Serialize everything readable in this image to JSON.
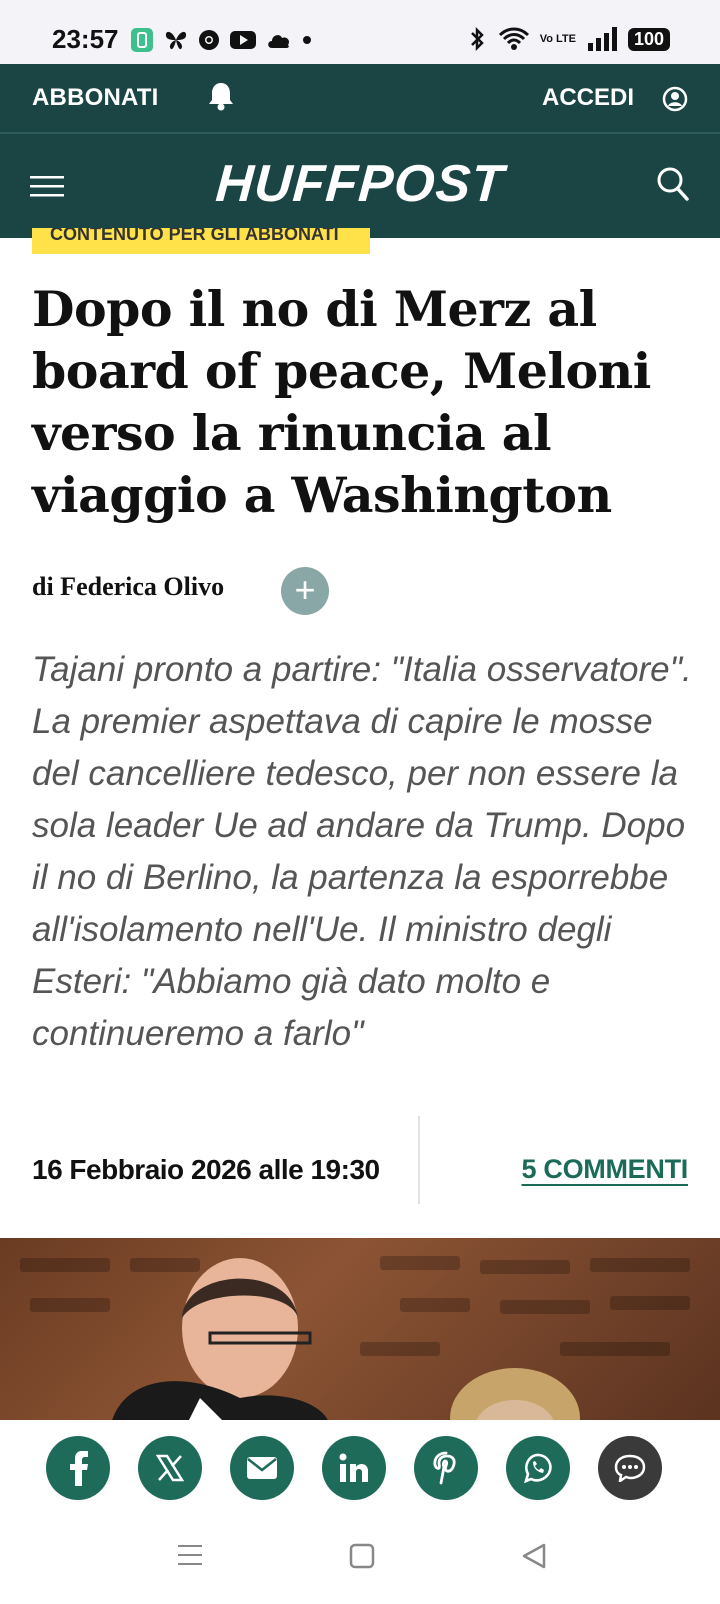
{
  "status_bar": {
    "time": "23:57",
    "battery": "100",
    "network": "Vo LTE",
    "app_icons": [
      "battery-saver-icon",
      "butterfly-icon",
      "chrome-icon",
      "youtube-icon",
      "cloud-icon",
      "dot-icon"
    ],
    "system_icons": [
      "bluetooth-icon",
      "wifi-icon",
      "signal-icon"
    ]
  },
  "top_bar": {
    "subscribe_label": "ABBONATI",
    "login_label": "ACCEDI"
  },
  "brand_bar": {
    "logo": "HUFFPOST"
  },
  "article": {
    "tag": "CONTENUTO PER GLI ABBONATI",
    "headline": "Dopo il no di Merz al board of peace, Meloni verso la rinuncia al viaggio a Washington",
    "byline": "di Federica Olivo",
    "follow_icon": "+",
    "summary": "Tajani pronto a partire: \"Italia osservatore\".  La premier aspettava di capire le mosse del cancelliere tedesco, per non essere la sola leader Ue ad andare da Trump. Dopo il no di Berlino, la partenza la esporrebbe all'isolamento nell'Ue. Il ministro degli Esteri: \"Abbiamo già dato molto e continueremo a farlo\"",
    "date": "16 Febbraio 2026 alle 19:30",
    "comments": "5 COMMENTI"
  },
  "share": {
    "buttons": [
      "facebook",
      "x",
      "email",
      "linkedin",
      "pinterest",
      "whatsapp",
      "comments"
    ]
  },
  "colors": {
    "brand": "#1b4545",
    "share": "#1f6b5a",
    "tag": "#ffe24a",
    "accent": "#1b6b58"
  }
}
